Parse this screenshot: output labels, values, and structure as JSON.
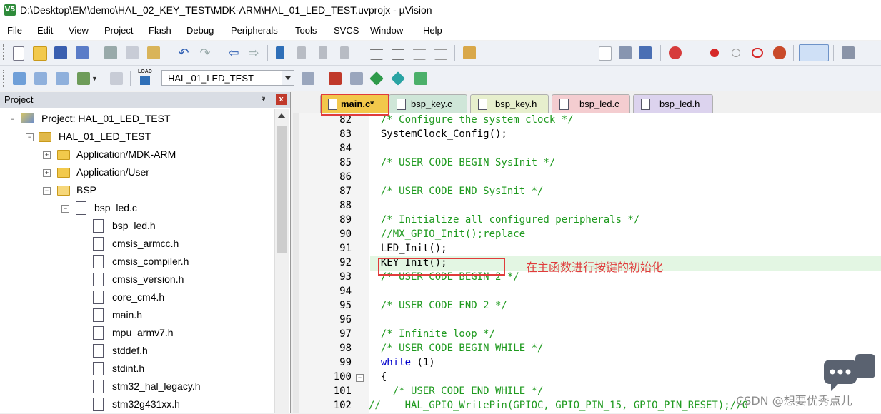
{
  "window": {
    "title": "D:\\Desktop\\EM\\demo\\HAL_02_KEY_TEST\\MDK-ARM\\HAL_01_LED_TEST.uvprojx - µVision",
    "icon_text": "V5"
  },
  "menu": [
    "File",
    "Edit",
    "View",
    "Project",
    "Flash",
    "Debug",
    "Peripherals",
    "Tools",
    "SVCS",
    "Window",
    "Help"
  ],
  "toolbar": {
    "target": "HAL_01_LED_TEST",
    "load_label": "LOAD"
  },
  "project_panel": {
    "title": "Project",
    "pin": "ᵠ",
    "close": "x",
    "tree": [
      {
        "label": "Project: HAL_01_LED_TEST",
        "expander": "−",
        "icon": "project-icon"
      },
      {
        "label": "HAL_01_LED_TEST",
        "expander": "−",
        "icon": "target-icon"
      },
      {
        "label": "Application/MDK-ARM",
        "expander": "+",
        "icon": "folder-icon"
      },
      {
        "label": "Application/User",
        "expander": "+",
        "icon": "folder-icon"
      },
      {
        "label": "BSP",
        "expander": "−",
        "icon": "folder-open-icon"
      },
      {
        "label": "bsp_led.c",
        "expander": "−",
        "icon": "file-icon"
      },
      {
        "label": "bsp_led.h",
        "expander": "",
        "icon": "file-icon"
      },
      {
        "label": "cmsis_armcc.h",
        "expander": "",
        "icon": "file-icon"
      },
      {
        "label": "cmsis_compiler.h",
        "expander": "",
        "icon": "file-icon"
      },
      {
        "label": "cmsis_version.h",
        "expander": "",
        "icon": "file-icon"
      },
      {
        "label": "core_cm4.h",
        "expander": "",
        "icon": "file-icon"
      },
      {
        "label": "main.h",
        "expander": "",
        "icon": "file-icon"
      },
      {
        "label": "mpu_armv7.h",
        "expander": "",
        "icon": "file-icon"
      },
      {
        "label": "stddef.h",
        "expander": "",
        "icon": "file-icon"
      },
      {
        "label": "stdint.h",
        "expander": "",
        "icon": "file-icon"
      },
      {
        "label": "stm32_hal_legacy.h",
        "expander": "",
        "icon": "file-icon"
      },
      {
        "label": "stm32g431xx.h",
        "expander": "",
        "icon": "file-icon"
      }
    ]
  },
  "editor": {
    "tabs": [
      {
        "label": "main.c*",
        "active": true,
        "color": "#f2c84b"
      },
      {
        "label": "bsp_key.c",
        "active": false,
        "color": "#cfe6d8"
      },
      {
        "label": "bsp_key.h",
        "active": false,
        "color": "#e7efcd"
      },
      {
        "label": "bsp_led.c",
        "active": false,
        "color": "#f4cdd0"
      },
      {
        "label": "bsp_led.h",
        "active": false,
        "color": "#dcd3ee"
      }
    ],
    "lines": [
      {
        "n": "82",
        "code": "  /* Configure the system clock */",
        "kind": "cmt"
      },
      {
        "n": "83",
        "code": "  SystemClock_Config();",
        "kind": "txt"
      },
      {
        "n": "84",
        "code": "",
        "kind": "txt"
      },
      {
        "n": "85",
        "code": "  /* USER CODE BEGIN SysInit */",
        "kind": "cmt"
      },
      {
        "n": "86",
        "code": "",
        "kind": "txt"
      },
      {
        "n": "87",
        "code": "  /* USER CODE END SysInit */",
        "kind": "cmt"
      },
      {
        "n": "88",
        "code": "",
        "kind": "txt"
      },
      {
        "n": "89",
        "code": "  /* Initialize all configured peripherals */",
        "kind": "cmt"
      },
      {
        "n": "90",
        "code": "  //MX_GPIO_Init();replace",
        "kind": "cmt"
      },
      {
        "n": "91",
        "code": "  LED_Init();",
        "kind": "txt"
      },
      {
        "n": "92",
        "code": "  KEY_Init();",
        "kind": "txt"
      },
      {
        "n": "93",
        "code": "  /* USER CODE BEGIN 2 */",
        "kind": "cmt"
      },
      {
        "n": "94",
        "code": "",
        "kind": "txt"
      },
      {
        "n": "95",
        "code": "  /* USER CODE END 2 */",
        "kind": "cmt"
      },
      {
        "n": "96",
        "code": "",
        "kind": "txt"
      },
      {
        "n": "97",
        "code": "  /* Infinite loop */",
        "kind": "cmt"
      },
      {
        "n": "98",
        "code": "  /* USER CODE BEGIN WHILE */",
        "kind": "cmt"
      },
      {
        "n": "99",
        "code": "  while",
        "kind": "kw",
        "rest": " (1)"
      },
      {
        "n": "100",
        "code": "  {",
        "kind": "txt"
      },
      {
        "n": "101",
        "code": "    /* USER CODE END WHILE */",
        "kind": "cmt"
      },
      {
        "n": "102",
        "code": "//    HAL_GPIO_WritePin(GPIOC, GPIO_PIN_15, GPIO_PIN_RESET);//0",
        "kind": "cmt"
      }
    ]
  },
  "annotation": "在主函数进行按键的初始化",
  "watermark": "CSDN @想要优秀点儿"
}
